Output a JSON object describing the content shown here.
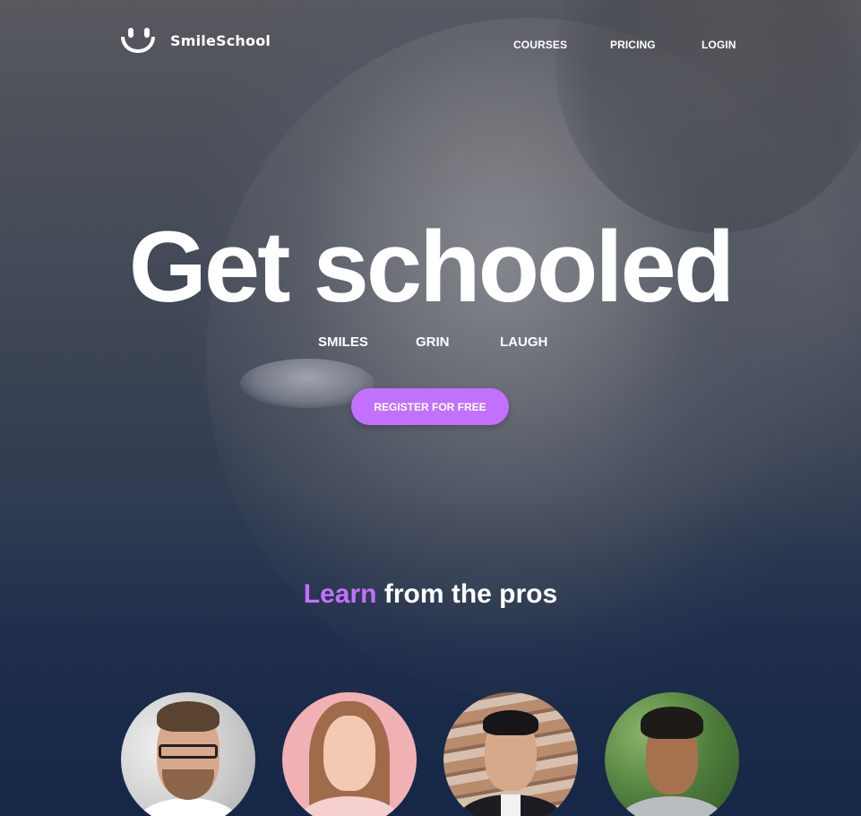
{
  "brand": {
    "name": "SmileSchool",
    "logo_icon": "smile-logo-icon"
  },
  "nav": {
    "courses": "COURSES",
    "pricing": "PRICING",
    "login": "LOGIN"
  },
  "hero": {
    "headline": "Get schooled",
    "tags": [
      "SMILES",
      "GRIN",
      "LAUGH"
    ],
    "cta": "REGISTER FOR FREE"
  },
  "section": {
    "title_accent": "Learn",
    "title_rest": " from the pros"
  },
  "colors": {
    "accent": "#c271ff",
    "text": "#ffffff",
    "bottom": "#1a2b49"
  },
  "instructors": [
    {
      "name": "instructor-1"
    },
    {
      "name": "instructor-2"
    },
    {
      "name": "instructor-3"
    },
    {
      "name": "instructor-4"
    }
  ]
}
